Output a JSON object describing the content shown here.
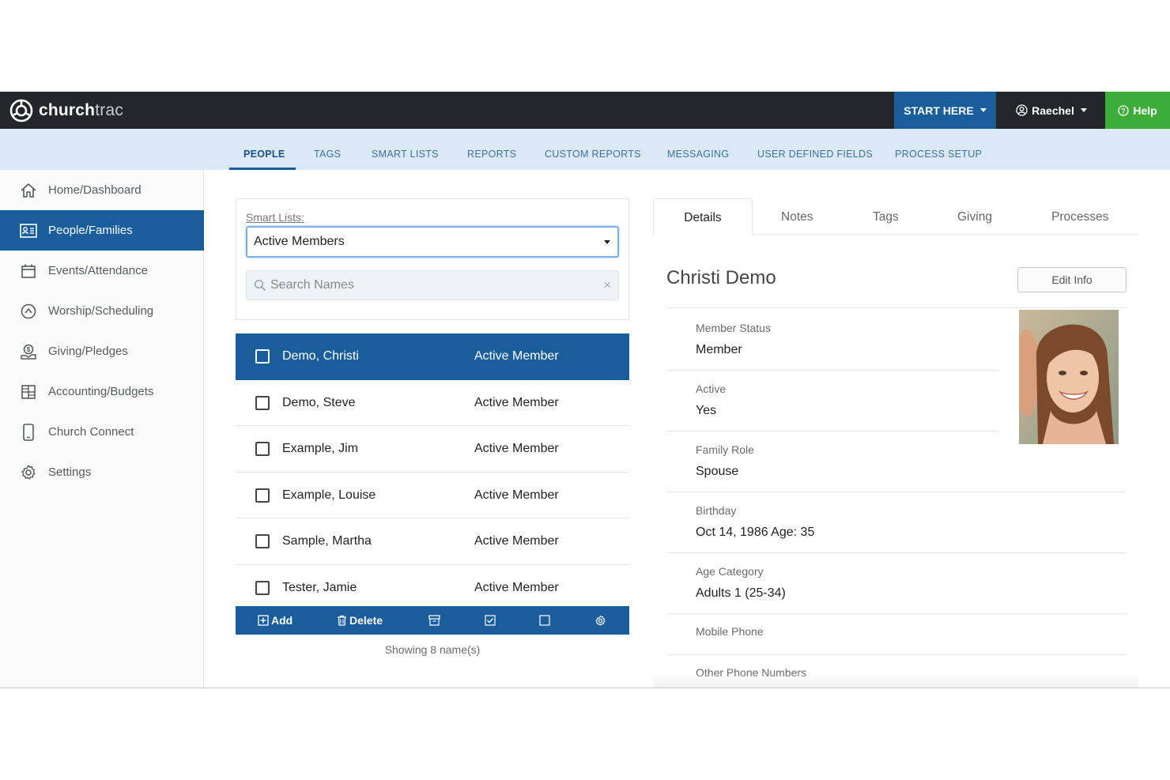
{
  "topbar": {
    "logo_bold": "church",
    "logo_light": "trac",
    "start_here": "START HERE",
    "user": "Raechel",
    "help": "Help"
  },
  "subnav": {
    "tabs": [
      {
        "label": "PEOPLE",
        "active": true
      },
      {
        "label": "TAGS"
      },
      {
        "label": "SMART LISTS"
      },
      {
        "label": "REPORTS"
      },
      {
        "label": "CUSTOM REPORTS"
      },
      {
        "label": "MESSAGING"
      },
      {
        "label": "USER DEFINED FIELDS"
      },
      {
        "label": "PROCESS SETUP"
      }
    ]
  },
  "sidebar": {
    "items": [
      {
        "label": "Home/Dashboard",
        "icon": "home-icon"
      },
      {
        "label": "People/Families",
        "icon": "id-card-icon",
        "active": true
      },
      {
        "label": "Events/Attendance",
        "icon": "calendar-icon"
      },
      {
        "label": "Worship/Scheduling",
        "icon": "worship-icon"
      },
      {
        "label": "Giving/Pledges",
        "icon": "giving-icon"
      },
      {
        "label": "Accounting/Budgets",
        "icon": "grid-icon"
      },
      {
        "label": "Church Connect",
        "icon": "phone-icon"
      },
      {
        "label": "Settings",
        "icon": "gear-icon"
      }
    ]
  },
  "filter": {
    "label": "Smart Lists:",
    "selected": "Active Members",
    "search_placeholder": "Search Names",
    "clear": "×"
  },
  "people": {
    "rows": [
      {
        "name": "Demo, Christi",
        "status": "Active Member",
        "selected": true
      },
      {
        "name": "Demo, Steve",
        "status": "Active Member"
      },
      {
        "name": "Example, Jim",
        "status": "Active Member"
      },
      {
        "name": "Example, Louise",
        "status": "Active Member"
      },
      {
        "name": "Sample, Martha",
        "status": "Active Member"
      },
      {
        "name": "Tester, Jamie",
        "status": "Active Member"
      }
    ],
    "toolbar": {
      "add": "Add",
      "delete": "Delete"
    },
    "showing": "Showing 8 name(s)"
  },
  "detail": {
    "tabs": [
      {
        "label": "Details",
        "active": true
      },
      {
        "label": "Notes"
      },
      {
        "label": "Tags"
      },
      {
        "label": "Giving"
      },
      {
        "label": "Processes"
      }
    ],
    "name": "Christi Demo",
    "edit_button": "Edit Info",
    "fields": [
      {
        "label": "Member Status",
        "value": "Member"
      },
      {
        "label": "Active",
        "value": "Yes"
      },
      {
        "label": "Family Role",
        "value": "Spouse"
      },
      {
        "label": "Birthday",
        "value": "Oct 14, 1986 Age: 35"
      },
      {
        "label": "Age Category",
        "value": "Adults 1 (25-34)"
      },
      {
        "label": "Mobile Phone",
        "value": ""
      },
      {
        "label": "Other Phone Numbers",
        "value": ""
      }
    ]
  },
  "colors": {
    "topbar": "#23262b",
    "primary": "#1a5d9b",
    "help": "#3dad3a",
    "subnav": "#dbe9f6"
  }
}
